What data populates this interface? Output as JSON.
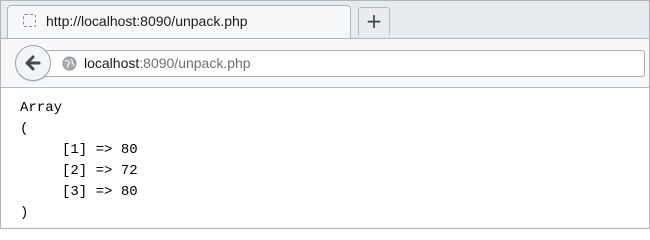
{
  "tab": {
    "title": "http://localhost:8090/unpack.php",
    "favicon": "blank-page-icon"
  },
  "new_tab": {
    "label": "+"
  },
  "navbar": {
    "back_icon": "back-arrow-icon",
    "site_icon": "globe-icon",
    "url_host": "localhost",
    "url_rest": ":8090/unpack.php"
  },
  "output": {
    "header": "Array",
    "open": "(",
    "items": [
      {
        "key": "[1]",
        "arrow": "=>",
        "value": "80"
      },
      {
        "key": "[2]",
        "arrow": "=>",
        "value": "72"
      },
      {
        "key": "[3]",
        "arrow": "=>",
        "value": "80"
      }
    ],
    "close": ")"
  },
  "colors": {
    "tabstrip_bg": "#e7eaee",
    "toolbar_bg": "#f7f8f9",
    "url_host": "#1a1a1a",
    "url_rest": "#707070"
  }
}
